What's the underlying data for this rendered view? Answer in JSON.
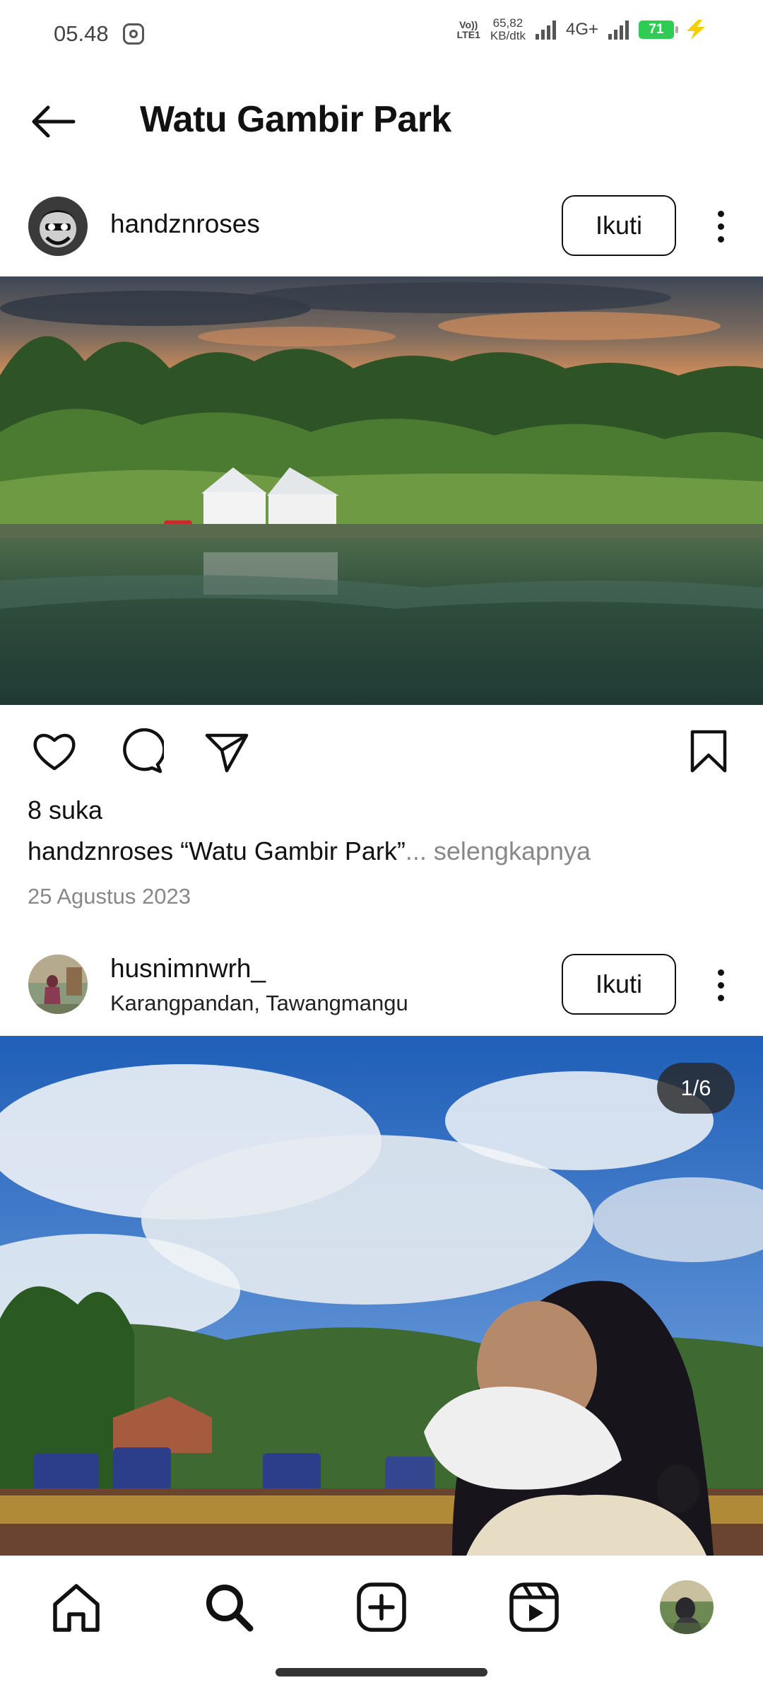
{
  "status_bar": {
    "time": "05.48",
    "volte_top": "Vo))",
    "volte_bottom": "LTE1",
    "net_speed_value": "65,82",
    "net_speed_unit": "KB/dtk",
    "network_type": "4G+",
    "battery_level": "71",
    "icons": [
      "instagram-icon",
      "signal-icon",
      "signal-icon",
      "battery-icon",
      "charging-bolt-icon"
    ]
  },
  "header": {
    "title": "Watu Gambir Park",
    "back_icon": "arrow-left-icon"
  },
  "posts": [
    {
      "username": "handznroses",
      "location": "",
      "follow_label": "Ikuti",
      "image": "lakeside-park-sunset-photo",
      "likes": "8 suka",
      "caption_user": "handznroses",
      "caption_text": " “Watu Gambir Park”",
      "caption_more": "... selengkapnya",
      "date": "25 Agustus 2023"
    },
    {
      "username": "husnimnwrh_",
      "location": "Karangpandan, Tawangmangu",
      "follow_label": "Ikuti",
      "image": "hijab-girl-selfie-crowd-photo",
      "counter": "1/6"
    }
  ],
  "actions": {
    "icons": [
      "heart-icon",
      "comment-icon",
      "share-icon",
      "bookmark-icon"
    ]
  },
  "bottom_nav": {
    "items": [
      "home-icon",
      "search-icon",
      "create-icon",
      "reels-icon",
      "profile-avatar"
    ]
  },
  "colors": {
    "background": "#ffffff",
    "text": "#111111",
    "secondary_text": "#888888",
    "battery": "#2ecc55",
    "bolt": "#f5d000"
  }
}
